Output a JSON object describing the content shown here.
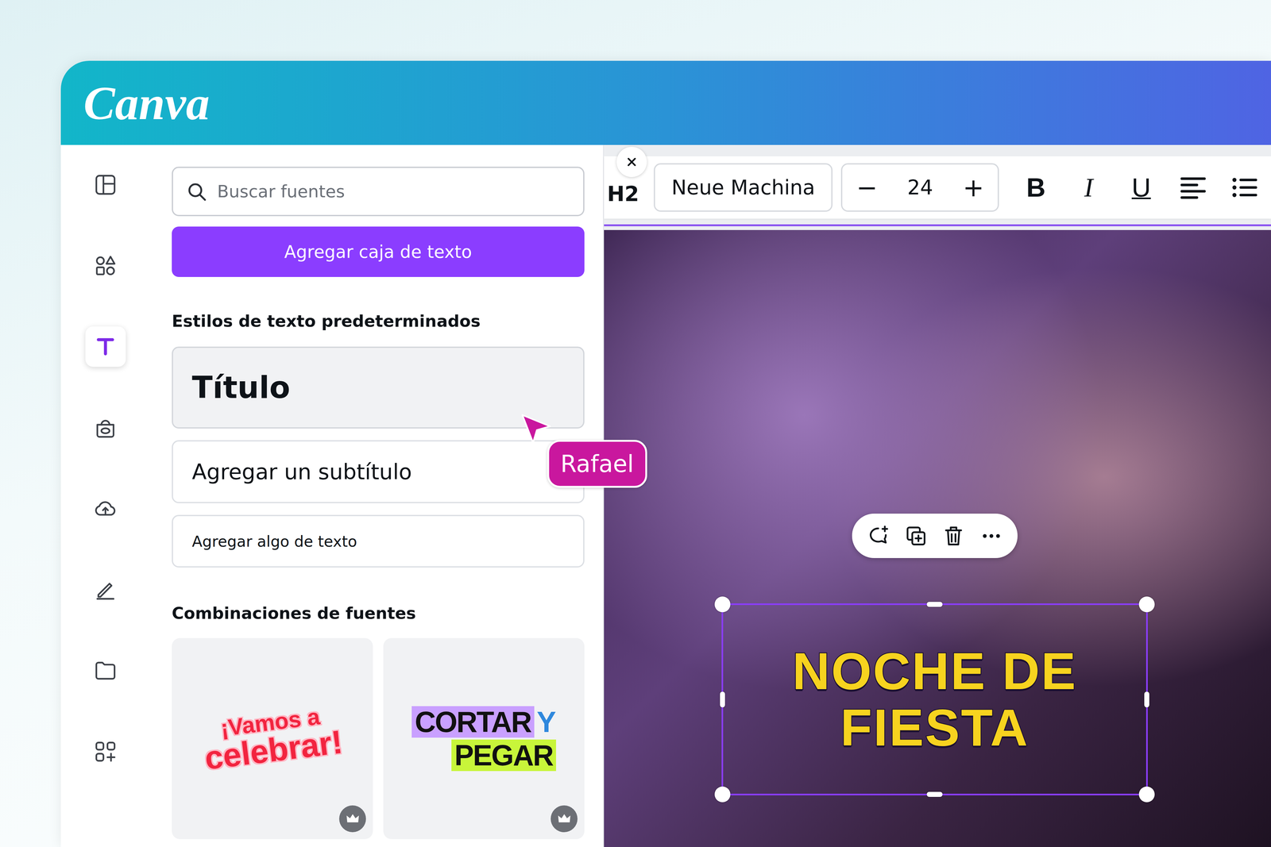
{
  "app": {
    "logo": "Canva"
  },
  "rail": {
    "items": [
      {
        "kind": "layout",
        "selected": false
      },
      {
        "kind": "elements",
        "selected": false
      },
      {
        "kind": "text",
        "selected": true
      },
      {
        "kind": "brand",
        "selected": false
      },
      {
        "kind": "uploads",
        "selected": false
      },
      {
        "kind": "draw",
        "selected": false
      },
      {
        "kind": "projects",
        "selected": false
      },
      {
        "kind": "apps",
        "selected": false
      }
    ]
  },
  "panel": {
    "search": {
      "placeholder": "Buscar fuentes"
    },
    "add_button": "Agregar caja de texto",
    "styles_heading": "Estilos de texto predeterminados",
    "text_styles": [
      {
        "label": "Título",
        "kind": "title",
        "hovered": true
      },
      {
        "label": "Agregar un subtítulo",
        "kind": "subtitle",
        "hovered": false
      },
      {
        "label": "Agregar algo de texto",
        "kind": "body",
        "hovered": false
      }
    ],
    "combos_heading": "Combinaciones de fuentes",
    "combos": [
      {
        "kind": "celebrate",
        "lines": [
          "¡Vamos a",
          "celebrar!"
        ],
        "premium": true
      },
      {
        "kind": "cutpaste",
        "lines": [
          "CORTAR",
          "Y",
          "PEGAR"
        ],
        "premium": true
      }
    ]
  },
  "toolbar": {
    "heading_level": "H2",
    "font": "Neue Machina",
    "minus": "−",
    "size": "24",
    "plus": "+",
    "styles": [
      "B",
      "I",
      "U"
    ]
  },
  "canvas": {
    "design_text": [
      "NOCHE DE",
      "FIESTA"
    ],
    "selected": true
  },
  "collaborator": {
    "name": "Rafael",
    "color": "#c9179e"
  }
}
